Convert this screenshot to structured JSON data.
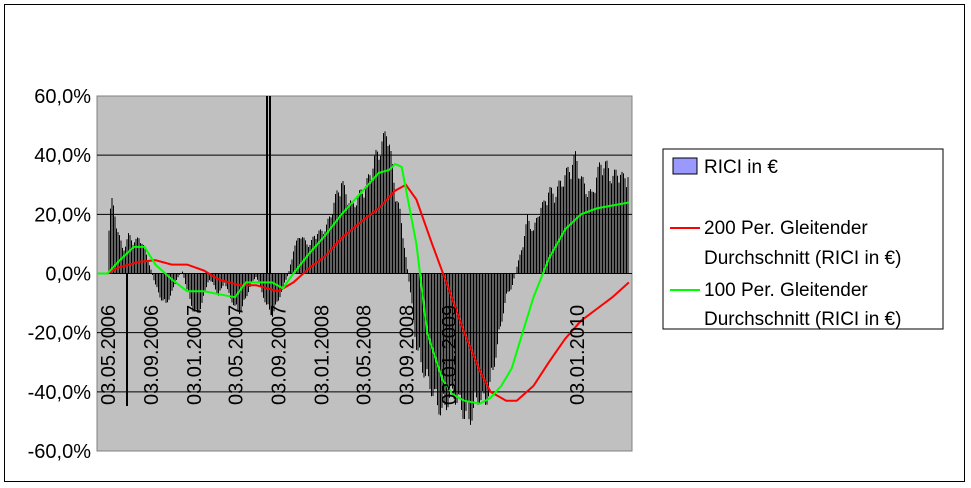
{
  "chart_data": {
    "type": "bar",
    "title": "",
    "xlabel": "",
    "ylabel": "",
    "ylim": [
      -60,
      60
    ],
    "y_unit": "%",
    "yticks": [
      60,
      40,
      20,
      0,
      -20,
      -40,
      -60
    ],
    "ytick_labels": [
      "60,0%",
      "40,0%",
      "20,0%",
      "0,0%",
      "-20,0%",
      "-40,0%",
      "-60,0%"
    ],
    "x_range": [
      "2006-04-01",
      "2010-06-10"
    ],
    "xticks": [
      {
        "date": "2006-05-03",
        "label": "03.05.2006"
      },
      {
        "date": "2006-09-03",
        "label": "03.09.2006"
      },
      {
        "date": "2007-01-03",
        "label": "03.01.2007"
      },
      {
        "date": "2007-05-03",
        "label": "03.05.2007"
      },
      {
        "date": "2007-09-03",
        "label": "03.09.2007"
      },
      {
        "date": "2008-01-03",
        "label": "03.01.2008"
      },
      {
        "date": "2008-05-03",
        "label": "03.05.2008"
      },
      {
        "date": "2008-09-03",
        "label": "03.09.2008"
      },
      {
        "date": "2009-01-03",
        "label": "03.01.2009"
      },
      {
        "date": "2010-01-03",
        "label": "03.01.2010"
      }
    ],
    "grid": true,
    "plot_background": "#c0c0c0",
    "legend_position": "right",
    "legend": [
      {
        "label": "RICI in €",
        "type": "bar",
        "color": "#9999ff"
      },
      {
        "label": "200 Per. Gleitender Durchschnitt (RICI in €)",
        "type": "line",
        "color": "#ff0000"
      },
      {
        "label": "100 Per. Gleitender Durchschnitt (RICI in €)",
        "type": "line",
        "color": "#00ff00"
      }
    ],
    "series": [
      {
        "name": "RICI in €",
        "type": "bar",
        "color": "#000000",
        "points": [
          [
            "2006-04-01",
            0
          ],
          [
            "2006-04-20",
            0
          ],
          [
            "2006-05-01",
            0
          ],
          [
            "2006-05-05",
            17
          ],
          [
            "2006-05-12",
            27
          ],
          [
            "2006-05-20",
            22
          ],
          [
            "2006-06-01",
            15
          ],
          [
            "2006-06-15",
            8
          ],
          [
            "2006-07-01",
            14
          ],
          [
            "2006-07-15",
            11
          ],
          [
            "2006-08-01",
            13
          ],
          [
            "2006-08-15",
            9
          ],
          [
            "2006-09-01",
            2
          ],
          [
            "2006-09-15",
            -4
          ],
          [
            "2006-10-01",
            -9
          ],
          [
            "2006-10-15",
            -11
          ],
          [
            "2006-11-01",
            -7
          ],
          [
            "2006-11-15",
            -2
          ],
          [
            "2006-12-01",
            1
          ],
          [
            "2006-12-15",
            -6
          ],
          [
            "2007-01-01",
            -13
          ],
          [
            "2007-01-15",
            -15
          ],
          [
            "2007-02-01",
            -8
          ],
          [
            "2007-02-15",
            -2
          ],
          [
            "2007-03-01",
            -4
          ],
          [
            "2007-03-15",
            -8
          ],
          [
            "2007-04-01",
            -3
          ],
          [
            "2007-04-15",
            -8
          ],
          [
            "2007-05-01",
            -12
          ],
          [
            "2007-05-15",
            -14
          ],
          [
            "2007-06-01",
            -9
          ],
          [
            "2007-06-15",
            -4
          ],
          [
            "2007-07-01",
            -1
          ],
          [
            "2007-07-15",
            -6
          ],
          [
            "2007-08-01",
            -12
          ],
          [
            "2007-08-15",
            -15
          ],
          [
            "2007-09-01",
            -10
          ],
          [
            "2007-09-15",
            -5
          ],
          [
            "2007-10-01",
            0
          ],
          [
            "2007-10-15",
            8
          ],
          [
            "2007-11-01",
            14
          ],
          [
            "2007-11-15",
            12
          ],
          [
            "2007-12-01",
            10
          ],
          [
            "2007-12-15",
            14
          ],
          [
            "2008-01-01",
            15
          ],
          [
            "2008-01-15",
            16
          ],
          [
            "2008-02-01",
            22
          ],
          [
            "2008-02-15",
            28
          ],
          [
            "2008-03-01",
            33
          ],
          [
            "2008-03-15",
            28
          ],
          [
            "2008-04-01",
            24
          ],
          [
            "2008-04-15",
            27
          ],
          [
            "2008-05-01",
            30
          ],
          [
            "2008-05-15",
            33
          ],
          [
            "2008-06-01",
            40
          ],
          [
            "2008-06-15",
            44
          ],
          [
            "2008-07-01",
            48
          ],
          [
            "2008-07-10",
            53
          ],
          [
            "2008-07-20",
            42
          ],
          [
            "2008-08-01",
            30
          ],
          [
            "2008-08-15",
            22
          ],
          [
            "2008-09-01",
            6
          ],
          [
            "2008-09-15",
            -8
          ],
          [
            "2008-10-01",
            -26
          ],
          [
            "2008-10-15",
            -33
          ],
          [
            "2008-11-01",
            -38
          ],
          [
            "2008-11-15",
            -42
          ],
          [
            "2008-12-01",
            -47
          ],
          [
            "2008-12-15",
            -50
          ],
          [
            "2009-01-01",
            -45
          ],
          [
            "2009-01-15",
            -43
          ],
          [
            "2009-02-01",
            -47
          ],
          [
            "2009-02-15",
            -50
          ],
          [
            "2009-03-01",
            -53
          ],
          [
            "2009-03-15",
            -48
          ],
          [
            "2009-04-01",
            -44
          ],
          [
            "2009-04-15",
            -47
          ],
          [
            "2009-05-01",
            -40
          ],
          [
            "2009-05-15",
            -30
          ],
          [
            "2009-06-01",
            -18
          ],
          [
            "2009-06-15",
            -8
          ],
          [
            "2009-07-01",
            -5
          ],
          [
            "2009-07-15",
            2
          ],
          [
            "2009-08-01",
            10
          ],
          [
            "2009-08-15",
            20
          ],
          [
            "2009-09-01",
            15
          ],
          [
            "2009-09-15",
            22
          ],
          [
            "2009-10-01",
            25
          ],
          [
            "2009-10-15",
            30
          ],
          [
            "2009-11-01",
            28
          ],
          [
            "2009-11-15",
            32
          ],
          [
            "2009-12-01",
            35
          ],
          [
            "2009-12-15",
            38
          ],
          [
            "2010-01-01",
            42
          ],
          [
            "2010-01-15",
            34
          ],
          [
            "2010-02-01",
            30
          ],
          [
            "2010-02-15",
            28
          ],
          [
            "2010-03-01",
            35
          ],
          [
            "2010-03-15",
            40
          ],
          [
            "2010-04-01",
            38
          ],
          [
            "2010-04-15",
            34
          ],
          [
            "2010-05-01",
            37
          ],
          [
            "2010-05-15",
            34
          ],
          [
            "2010-06-01",
            36
          ]
        ]
      },
      {
        "name": "200 Per. Gleitender Durchschnitt (RICI in €)",
        "type": "line",
        "color": "#ff0000",
        "points": [
          [
            "2006-04-01",
            0
          ],
          [
            "2006-05-01",
            0
          ],
          [
            "2006-06-01",
            2
          ],
          [
            "2006-08-01",
            4
          ],
          [
            "2006-09-15",
            4.5
          ],
          [
            "2006-11-01",
            3
          ],
          [
            "2006-12-15",
            3
          ],
          [
            "2007-02-01",
            1
          ],
          [
            "2007-03-15",
            -2
          ],
          [
            "2007-05-15",
            -4
          ],
          [
            "2007-07-01",
            -4
          ],
          [
            "2007-08-01",
            -5
          ],
          [
            "2007-09-01",
            -6
          ],
          [
            "2007-10-15",
            -3
          ],
          [
            "2007-12-01",
            2
          ],
          [
            "2008-01-15",
            6
          ],
          [
            "2008-03-01",
            12
          ],
          [
            "2008-05-01",
            18
          ],
          [
            "2008-06-15",
            22
          ],
          [
            "2008-08-01",
            28
          ],
          [
            "2008-09-01",
            30
          ],
          [
            "2008-10-01",
            25
          ],
          [
            "2008-11-15",
            10
          ],
          [
            "2009-01-01",
            -5
          ],
          [
            "2009-02-15",
            -20
          ],
          [
            "2009-04-01",
            -33
          ],
          [
            "2009-05-01",
            -40
          ],
          [
            "2009-06-15",
            -43
          ],
          [
            "2009-07-15",
            -43
          ],
          [
            "2009-09-01",
            -38
          ],
          [
            "2009-10-15",
            -30
          ],
          [
            "2009-12-01",
            -22
          ],
          [
            "2010-01-15",
            -16
          ],
          [
            "2010-03-01",
            -12
          ],
          [
            "2010-04-15",
            -8
          ],
          [
            "2010-06-01",
            -3
          ]
        ]
      },
      {
        "name": "100 Per. Gleitender Durchschnitt (RICI in €)",
        "type": "line",
        "color": "#00ff00",
        "points": [
          [
            "2006-04-01",
            0
          ],
          [
            "2006-05-01",
            0
          ],
          [
            "2006-06-01",
            4
          ],
          [
            "2006-07-15",
            9
          ],
          [
            "2006-08-15",
            9
          ],
          [
            "2006-09-15",
            3
          ],
          [
            "2006-11-01",
            -2
          ],
          [
            "2006-12-15",
            -6
          ],
          [
            "2007-02-01",
            -6
          ],
          [
            "2007-03-15",
            -7
          ],
          [
            "2007-05-01",
            -8
          ],
          [
            "2007-06-01",
            -3
          ],
          [
            "2007-07-15",
            -3
          ],
          [
            "2007-08-15",
            -3
          ],
          [
            "2007-09-15",
            -5
          ],
          [
            "2007-10-15",
            0
          ],
          [
            "2007-12-01",
            7
          ],
          [
            "2008-01-15",
            13
          ],
          [
            "2008-03-01",
            20
          ],
          [
            "2008-05-01",
            28
          ],
          [
            "2008-06-15",
            34
          ],
          [
            "2008-07-15",
            35
          ],
          [
            "2008-08-01",
            37
          ],
          [
            "2008-08-20",
            36
          ],
          [
            "2008-10-01",
            10
          ],
          [
            "2008-11-01",
            -20
          ],
          [
            "2008-12-15",
            -36
          ],
          [
            "2009-01-15",
            -41
          ],
          [
            "2009-02-15",
            -43
          ],
          [
            "2009-04-01",
            -44
          ],
          [
            "2009-05-01",
            -42
          ],
          [
            "2009-06-01",
            -38
          ],
          [
            "2009-07-01",
            -32
          ],
          [
            "2009-08-01",
            -20
          ],
          [
            "2009-09-01",
            -8
          ],
          [
            "2009-10-15",
            5
          ],
          [
            "2009-12-01",
            15
          ],
          [
            "2010-01-15",
            20
          ],
          [
            "2010-03-01",
            22
          ],
          [
            "2010-04-15",
            23
          ],
          [
            "2010-06-01",
            24
          ]
        ]
      }
    ]
  }
}
